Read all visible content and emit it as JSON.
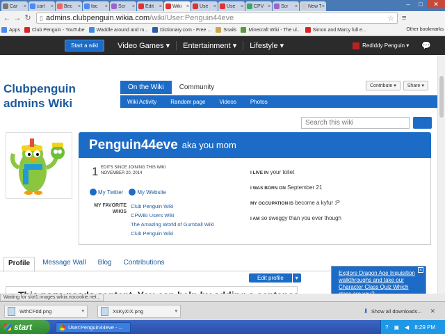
{
  "browser": {
    "tabs": [
      {
        "label": "Car",
        "color": "#777"
      },
      {
        "label": "carl",
        "color": "#4a8af4"
      },
      {
        "label": "Bec",
        "color": "#e66"
      },
      {
        "label": "fac",
        "color": "#4a8af4"
      },
      {
        "label": "Scr",
        "color": "#9966cc"
      },
      {
        "label": "Edit",
        "color": "#d33"
      },
      {
        "label": "Wiki",
        "color": "#d33"
      },
      {
        "label": "Use",
        "color": "#d33"
      },
      {
        "label": "Use",
        "color": "#d33"
      },
      {
        "label": "CPV",
        "color": "#3a6"
      },
      {
        "label": "Scr",
        "color": "#9966cc"
      },
      {
        "label": "New T",
        "color": "#ccc"
      }
    ],
    "url_host": "admins.clubpenguin.wikia.com",
    "url_path": "/wiki/User:Penguin44eve",
    "bookmarks": [
      {
        "label": "Apps",
        "color": "#4a8af4"
      },
      {
        "label": "Club Penguin - YouTube",
        "color": "#d22"
      },
      {
        "label": "Waddle around and m...",
        "color": "#3a8ee6"
      },
      {
        "label": "Dictionary.com - Free ...",
        "color": "#2a5da8"
      },
      {
        "label": "Snails",
        "color": "#c9a74a"
      },
      {
        "label": "Minecraft Wiki - The ul...",
        "color": "#5a9a3a"
      },
      {
        "label": "Simon and Marcy full e...",
        "color": "#d22"
      }
    ],
    "other_bookmarks": "Other bookmarks"
  },
  "wikia_bar": {
    "start_wiki": "Start a wiki",
    "hubs": [
      "Video Games ▾",
      "Entertainment ▾",
      "Lifestyle ▾"
    ],
    "username": "Rediddy Penguin ▾"
  },
  "wiki": {
    "name_line1": "Clubpenguin",
    "name_line2": "admins Wiki",
    "tab_on_wiki": "On the Wiki",
    "tab_community": "Community",
    "subnav": [
      "Wiki Activity",
      "Random page",
      "Videos",
      "Photos"
    ],
    "contribute": "Contribute ▾",
    "share": "Share ▾",
    "search_placeholder": "Search this wiki"
  },
  "profile": {
    "username": "Penguin44eve",
    "aka": "aka you mom",
    "edit_count": "1",
    "edits_label_1": "EDITS SINCE JOINING THIS WIKI",
    "edits_label_2": "NOVEMBER 20, 2014",
    "my_twitter": "My Twitter",
    "my_website": "My Website",
    "fav_wikis_label_1": "MY FAVORITE",
    "fav_wikis_label_2": "WIKIS",
    "fav_wikis": [
      "Club Penguin Wiki",
      "CPWiki Users Wiki",
      "The Amazing World of Gumball Wiki",
      "Club Penguin Wiki"
    ],
    "live_in_label": "I LIVE IN",
    "live_in": "your toilet",
    "born_label": "I WAS BORN ON",
    "born": "September 21",
    "occupation_label": "MY OCCUPATION IS",
    "occupation": "become a kyfur :P",
    "iam_label": "I AM",
    "iam": "so sweggy than you ever though"
  },
  "profile_tabs": [
    "Profile",
    "Message Wall",
    "Blog",
    "Contributions"
  ],
  "edit_profile": "Edit profile",
  "needs_content": "This page needs content. You can help by adding a sentence or a",
  "promo": "Explore Dragon Age Inquisition walkthroughs and take our Character Class Quiz Which class are you?",
  "status_text": "Waiting for slot1.images.wikia.nocookie.net...",
  "downloads": [
    "WthCFdd.png",
    "XsKyXIX.png"
  ],
  "show_all_downloads": "Show all downloads...",
  "taskbar": {
    "start": "start",
    "window": "User:Penguin44eve - ...",
    "clock": "8:29 PM"
  }
}
